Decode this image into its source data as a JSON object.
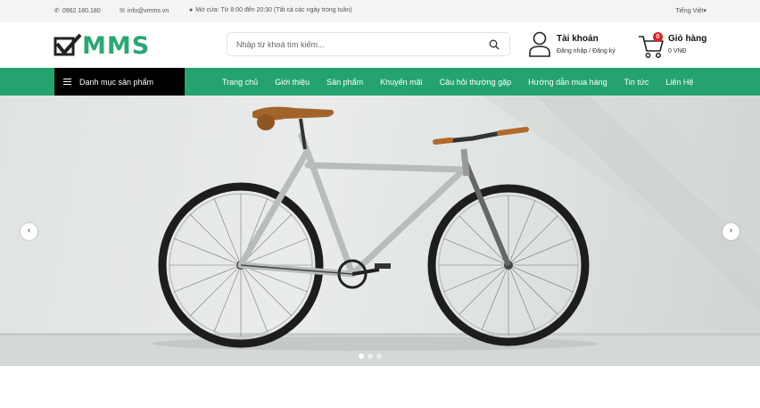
{
  "topbar": {
    "phone": "0962.180.180",
    "email": "info@vmms.vn",
    "hours": "Mở cửa: Từ 8:00 đến 20:30 (Tất cả các ngày trong tuần)",
    "language": "Tiếng Việt"
  },
  "header": {
    "logo_text": "MMS",
    "search_placeholder": "Nhập từ khoá tìm kiếm...",
    "account_title": "Tài khoản",
    "account_links": "Đăng nhập / Đăng ký",
    "cart_title": "Giỏ hàng",
    "cart_count": "0",
    "cart_total": "0 VNĐ"
  },
  "nav": {
    "category_label": "Danh mục sản phẩm",
    "items": [
      {
        "label": "Trang chủ"
      },
      {
        "label": "Giới thiệu"
      },
      {
        "label": "Sản phẩm"
      },
      {
        "label": "Khuyến mãi"
      },
      {
        "label": "Câu hỏi thường gặp"
      },
      {
        "label": "Hướng dẫn mua hàng"
      },
      {
        "label": "Tin tức"
      },
      {
        "label": "Liên Hệ"
      }
    ]
  },
  "slider": {
    "prev_icon": "‹",
    "next_icon": "›",
    "slide_count": 3,
    "active_slide": 1
  },
  "colors": {
    "brand_green": "#24a36f",
    "category_bg": "#000000",
    "badge_red": "#e01f1f"
  }
}
